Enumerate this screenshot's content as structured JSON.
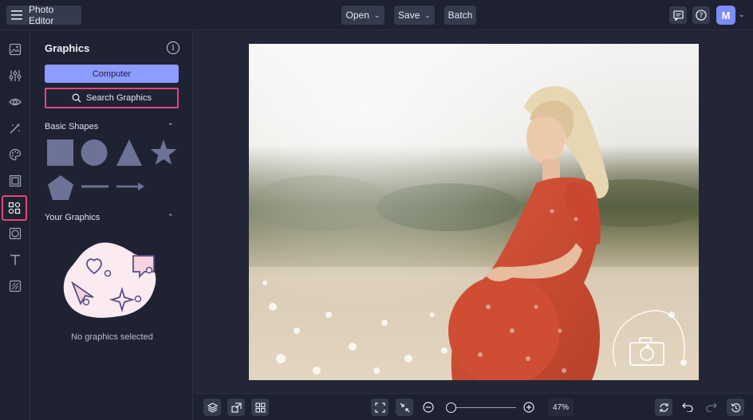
{
  "app": {
    "title": "Photo Editor"
  },
  "toolbar": {
    "open_label": "Open",
    "save_label": "Save",
    "batch_label": "Batch"
  },
  "user": {
    "avatar_initial": "M"
  },
  "rail": {
    "items": [
      "image-icon",
      "adjustments-icon",
      "eye-icon",
      "magic-icon",
      "palette-icon",
      "frames-icon",
      "graphics-icon",
      "overlay-icon",
      "text-icon",
      "textures-icon"
    ],
    "active": "graphics-icon"
  },
  "panel": {
    "title": "Graphics",
    "computer_label": "Computer",
    "search_label": "Search Graphics",
    "basic_shapes_label": "Basic Shapes",
    "your_graphics_label": "Your Graphics",
    "empty_label": "No graphics selected"
  },
  "canvas": {
    "watermark": "Click Click Photography"
  },
  "zoom": {
    "percent_label": "47%",
    "level": 0.05
  },
  "colors": {
    "accent": "#8e9bff",
    "highlight": "#e2467f",
    "shape_fill": "#6c7396"
  }
}
